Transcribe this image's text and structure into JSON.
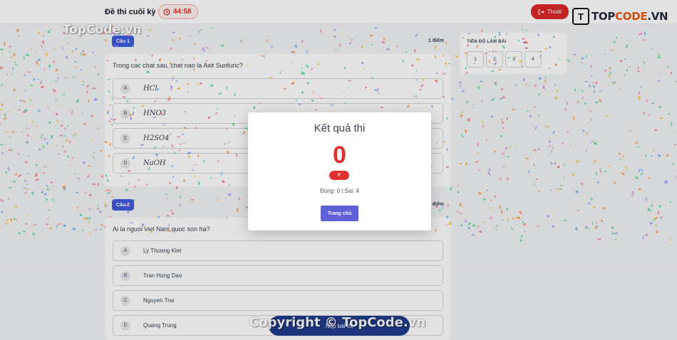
{
  "header": {
    "title": "Đề thi cuối kỳ",
    "timer": "44:58",
    "exit_label": "Thoát"
  },
  "brand": {
    "mark": "T",
    "name_main": "TOP",
    "name_accent": "CODE",
    "name_suffix": ".VN"
  },
  "watermarks": {
    "top": "TopCode.vn",
    "bottom": "Copyright © TopCode.vn"
  },
  "questions": [
    {
      "badge": "Câu 1",
      "points": "1 điểm",
      "text": "Trong cac chat sau, chat nao la Axit Sunfuric?",
      "options": [
        {
          "letter": "A",
          "text": "HCl"
        },
        {
          "letter": "B",
          "text": "HNO3"
        },
        {
          "letter": "C",
          "text": "H2SO4"
        },
        {
          "letter": "D",
          "text": "NaOH"
        }
      ]
    },
    {
      "badge": "Câu 2",
      "points": "1 điểm",
      "text": "Ai la nguoi viet Nam quoc son ha?",
      "options": [
        {
          "letter": "A",
          "text": "Ly Thuong Kiet"
        },
        {
          "letter": "B",
          "text": "Tran Hung Dao"
        },
        {
          "letter": "C",
          "text": "Nguyen Trai"
        },
        {
          "letter": "D",
          "text": "Quang Trung"
        }
      ]
    }
  ],
  "progress": {
    "title": "TIẾN ĐỘ LÀM BÀI",
    "items": [
      "1",
      "2",
      "3",
      "4"
    ]
  },
  "submit_label": "Nộp bài thi",
  "result_modal": {
    "title": "Kết quả thi",
    "score": "0",
    "grade": "F",
    "stats": "Đúng: 0 | Sai: 4",
    "home_label": "Trang chủ"
  },
  "colors": {
    "primary": "#3b5bdb",
    "danger": "#dc2626",
    "score": "#e03131",
    "home_button": "#5f5fd7",
    "submit_button": "#1e3a8a"
  }
}
